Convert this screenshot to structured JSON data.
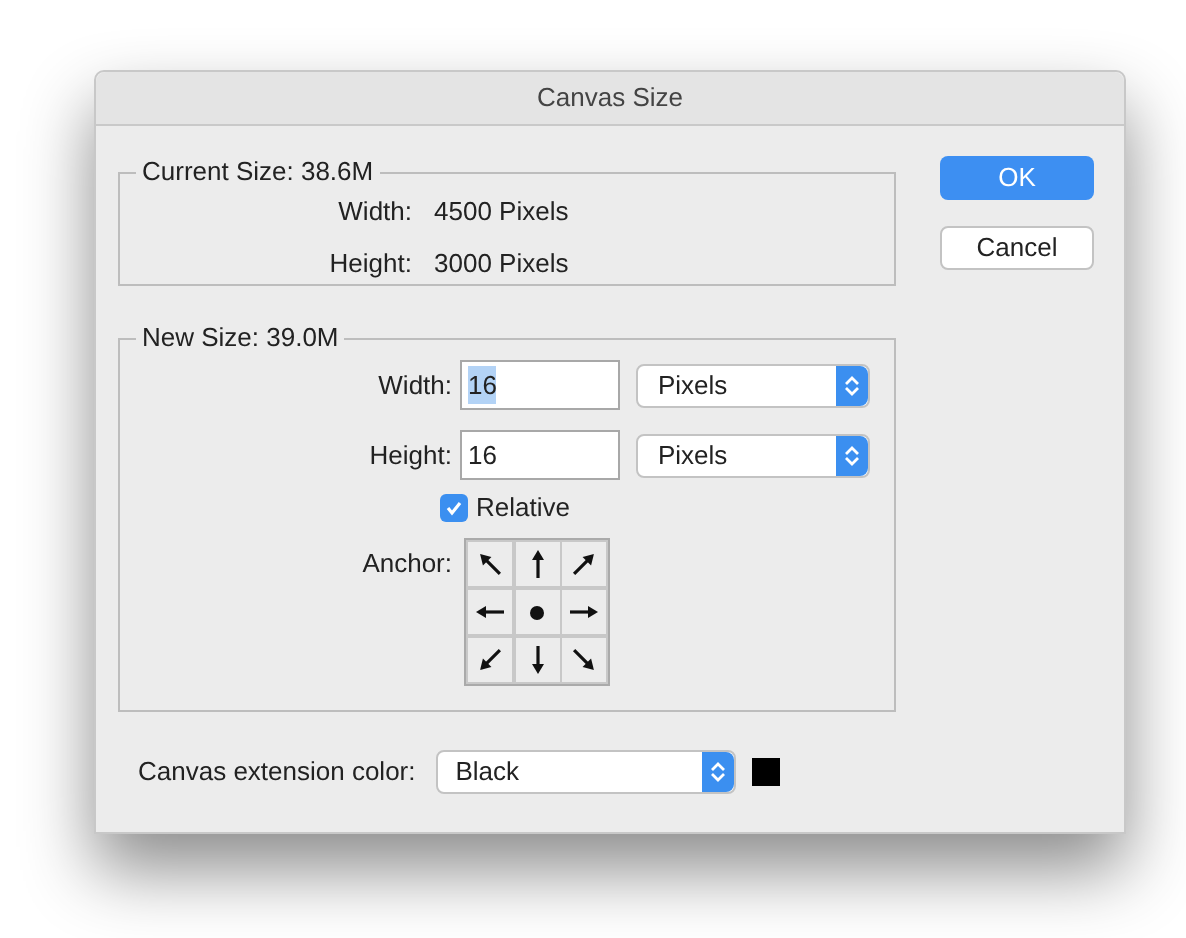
{
  "window": {
    "title": "Canvas Size"
  },
  "current_size": {
    "legend": "Current Size: 38.6M",
    "rows": [
      {
        "label": "Width:",
        "value": "4500 Pixels"
      },
      {
        "label": "Height:",
        "value": "3000 Pixels"
      }
    ]
  },
  "new_size": {
    "legend": "New Size: 39.0M",
    "rows": [
      {
        "label": "Width:",
        "value": "16",
        "text_selected": true,
        "unit": "Pixels"
      },
      {
        "label": "Height:",
        "value": "16",
        "text_selected": false,
        "unit": "Pixels"
      }
    ],
    "relative": {
      "label": "Relative",
      "checked": true
    },
    "anchor": {
      "label": "Anchor:",
      "cells": [
        {
          "selected": false
        },
        {
          "selected": false
        },
        {
          "selected": false
        },
        {
          "selected": false
        },
        {
          "selected": true
        },
        {
          "selected": false
        },
        {
          "selected": false
        },
        {
          "selected": false
        },
        {
          "selected": false
        }
      ]
    }
  },
  "extension_color": {
    "label": "Canvas extension color:",
    "value": "Black"
  },
  "buttons": [
    {
      "label": "OK",
      "kind": "default"
    },
    {
      "label": "Cancel",
      "kind": "normal"
    }
  ]
}
